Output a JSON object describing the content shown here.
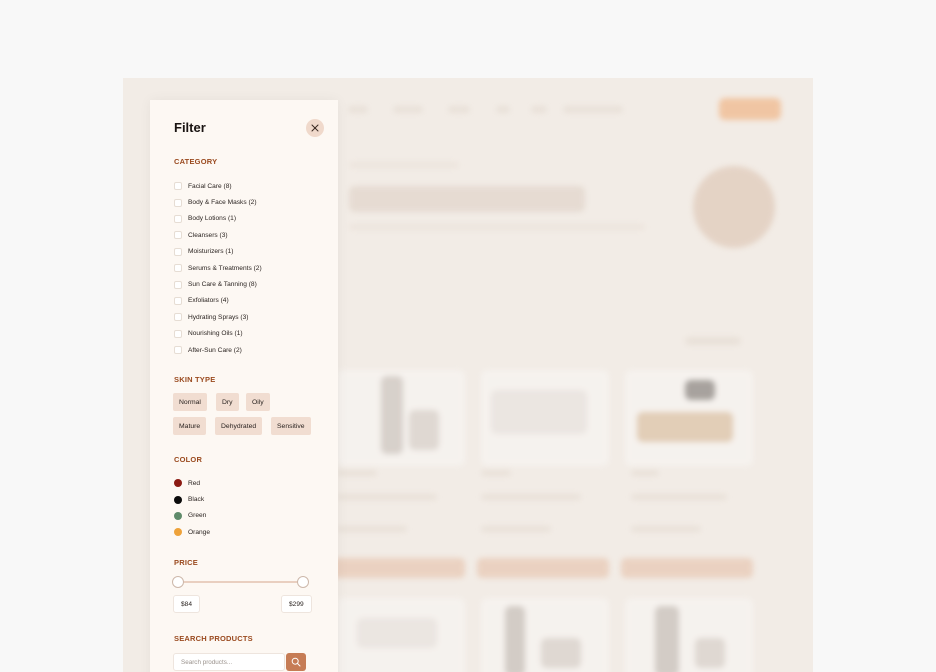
{
  "panel": {
    "title": "Filter",
    "close_icon": "close-icon"
  },
  "category": {
    "label": "CATEGORY",
    "items": [
      {
        "label": "Facial Care (8)"
      },
      {
        "label": "Body & Face Masks (2)"
      },
      {
        "label": "Body Lotions (1)"
      },
      {
        "label": "Cleansers (3)"
      },
      {
        "label": "Moisturizers (1)"
      },
      {
        "label": "Serums & Treatments (2)"
      },
      {
        "label": "Sun Care & Tanning (8)"
      },
      {
        "label": "Exfoliators (4)"
      },
      {
        "label": "Hydrating Sprays (3)"
      },
      {
        "label": "Nourishing Oils (1)"
      },
      {
        "label": "After-Sun Care (2)"
      }
    ]
  },
  "skin_type": {
    "label": "SKIN TYPE",
    "chips": [
      "Normal",
      "Dry",
      "Oily",
      "Mature",
      "Dehydrated",
      "Sensitive"
    ]
  },
  "color": {
    "label": "COLOR",
    "items": [
      {
        "label": "Red",
        "hex": "#8b1a12"
      },
      {
        "label": "Black",
        "hex": "#0b0b0b"
      },
      {
        "label": "Green",
        "hex": "#5f8a6a"
      },
      {
        "label": "Orange",
        "hex": "#eea23a"
      }
    ]
  },
  "price": {
    "label": "PRICE",
    "min": "$84",
    "max": "$299"
  },
  "search": {
    "label": "SEARCH PRODUCTS",
    "placeholder": "Search products...",
    "button_icon": "search-icon"
  },
  "colors": {
    "accent": "#c67c55",
    "section_label": "#9a4a1f",
    "panel_bg": "#fdf8f3",
    "chip_bg": "#f1ddd1"
  }
}
